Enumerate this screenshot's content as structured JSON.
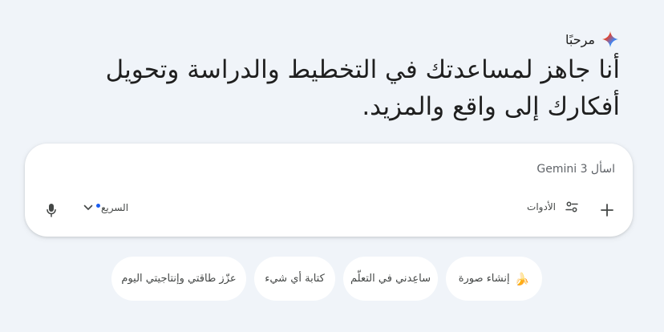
{
  "greeting": {
    "text": "مرحبًا",
    "icon": "gemini-sparkle-icon"
  },
  "headline": "أنا جاهز لمساعدتك في التخطيط والدراسة وتحويل أفكارك إلى واقع والمزيد.",
  "prompt": {
    "placeholder": "اسأل Gemini 3"
  },
  "toolbar": {
    "add_icon": "plus-icon",
    "tools_label": "الأدوات",
    "tools_icon": "tune-icon",
    "mode_label": "السريع",
    "mode_icon": "chevron-down-icon",
    "mic_icon": "microphone-icon"
  },
  "chips": [
    {
      "label": "إنشاء صورة",
      "emoji": "🍌"
    },
    {
      "label": "ساعِدني في التعلّم"
    },
    {
      "label": "كتابة أي شيء"
    },
    {
      "label": "عزّز طاقتي وإنتاجيتي اليوم"
    }
  ],
  "colors": {
    "background": "#f0f4f9",
    "card": "#ffffff",
    "accent_dot": "#1a5cf0"
  }
}
